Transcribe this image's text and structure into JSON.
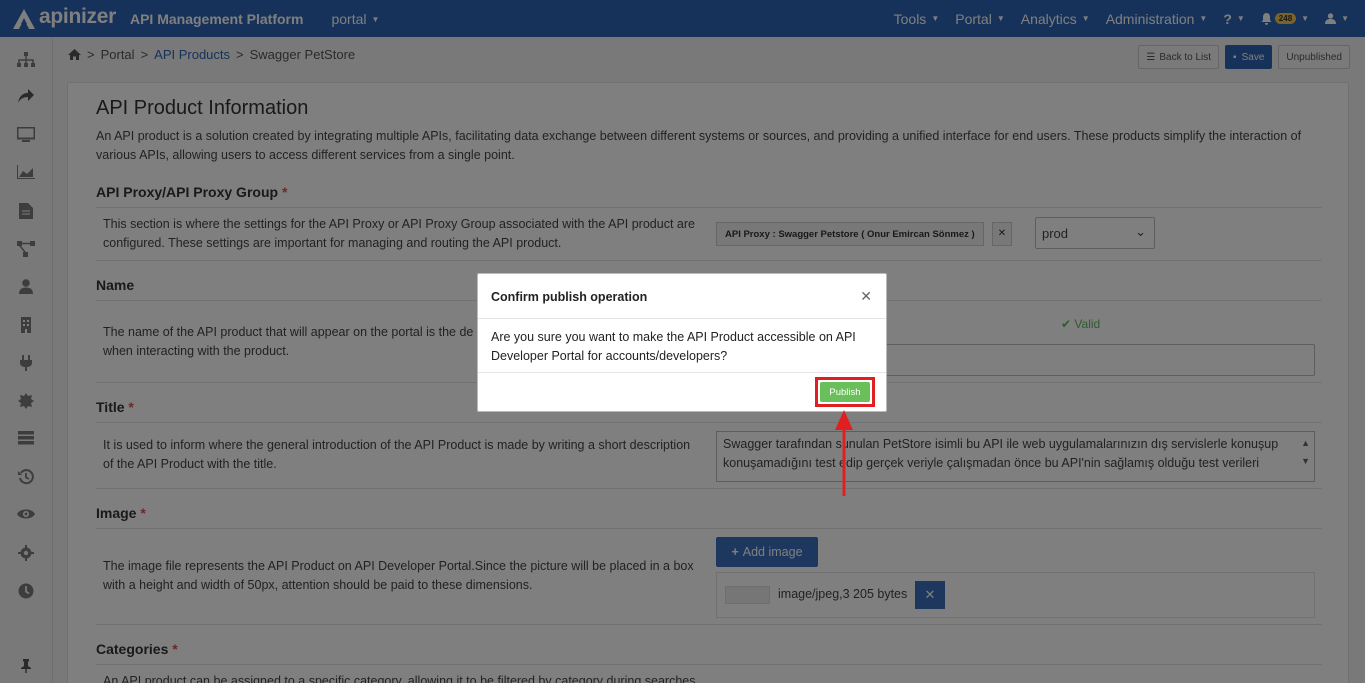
{
  "app": {
    "logo_text": "apinizer",
    "platform_title": "API Management Platform",
    "portal_select": "portal"
  },
  "topnav": {
    "items": [
      "Tools",
      "Portal",
      "Analytics",
      "Administration"
    ],
    "badge_count": "248"
  },
  "sidebar": {
    "icons": [
      "sitemap-icon",
      "share-icon",
      "monitor-icon",
      "chart-icon",
      "document-icon",
      "flow-icon",
      "user-icon",
      "building-icon",
      "plug-icon",
      "gear-badge-icon",
      "server-icon",
      "history-icon",
      "eye-icon",
      "settings-icon",
      "clock-icon",
      "pin-icon"
    ]
  },
  "breadcrumb": {
    "home": "Portal",
    "section": "API Products",
    "current": "Swagger PetStore"
  },
  "actions": {
    "back": "Back to List",
    "save": "Save",
    "status": "Unpublished"
  },
  "main": {
    "title": "API Product Information",
    "intro": "An API product is a solution created by integrating multiple APIs, facilitating data exchange between different systems or sources, and providing a unified interface for end users. These products simplify the interaction of various APIs, allowing users to access different services from a single point.",
    "proxy_section": {
      "title": "API Proxy/API Proxy Group",
      "desc": "This section is where the settings for the API Proxy or API Proxy Group associated with the API product are configured. These settings are important for managing and routing the API product.",
      "tag": "API Proxy : Swagger Petstore ( Onur Emircan Sönmez )",
      "env": "prod"
    },
    "name_section": {
      "title": "Name",
      "desc": "The name of the API product that will appear on the portal is the de",
      "desc2": "when interacting with the product.",
      "valid": "Valid"
    },
    "title_section": {
      "title": "Title",
      "desc": "It is used to inform where the general introduction of the API Product is made by writing a short description of the API Product with the title.",
      "value": "Swagger tarafından sunulan PetStore isimli bu API ile web uygulamalarınızın dış servislerle konuşup konuşamadığını test edip gerçek veriyle çalışmadan önce bu API'nin sağlamış olduğu test verileri"
    },
    "image_section": {
      "title": "Image",
      "desc": "The image file represents the API Product on API Developer Portal.Since the picture will be placed in a box with a height and width of 50px, attention should be paid to these dimensions.",
      "add_label": "Add image",
      "meta": "image/jpeg,3 205 bytes"
    },
    "categories_section": {
      "title": "Categories",
      "desc": "An API product can be assigned to a specific category, allowing it to be filtered by category during searches"
    }
  },
  "modal": {
    "title": "Confirm publish operation",
    "body": "Are you sure you want to make the API Product accessible on API Developer Portal for accounts/developers?",
    "publish": "Publish"
  },
  "colors": {
    "brand": "#2c64b4",
    "publish": "#6abf5a",
    "highlight": "#e02020"
  }
}
